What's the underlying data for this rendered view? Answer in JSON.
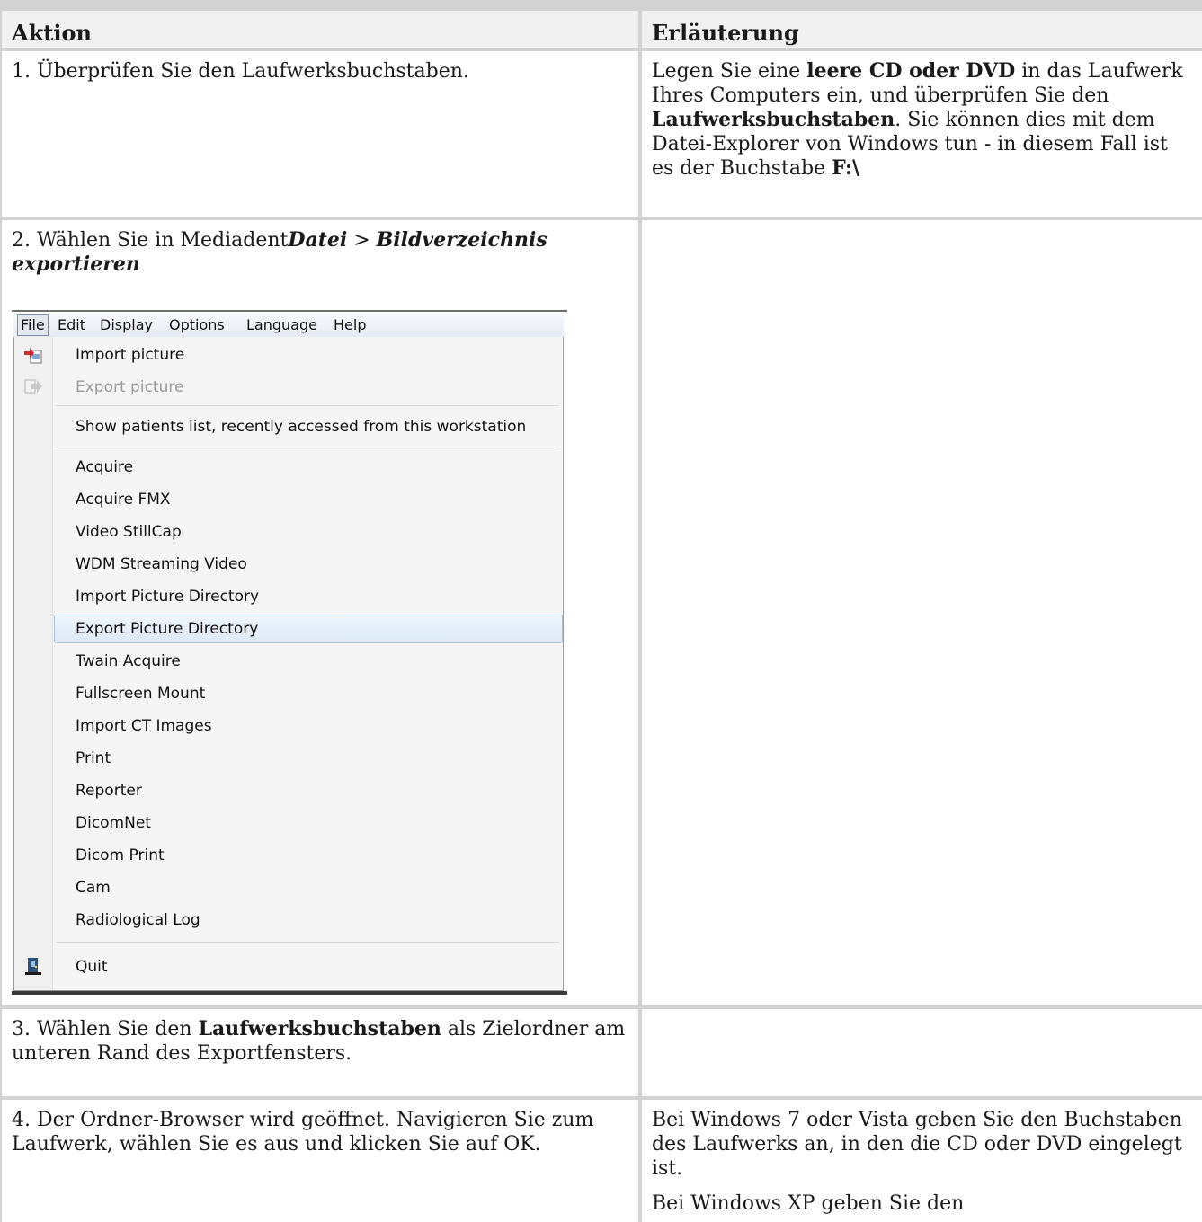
{
  "table": {
    "headers": [
      "Aktion",
      "Erläuterung"
    ],
    "rows": [
      {
        "action": {
          "prefix": "1. Überprüfen Sie den Laufwerksbuchstaben."
        },
        "explanation": {
          "p1": "Legen Sie eine ",
          "b1": "leere CD oder DVD",
          "p2": " in das Laufwerk Ihres Computers ein, und überprüfen Sie den ",
          "b2": "Laufwerksbuchstaben",
          "p3": ". Sie können dies mit dem Datei-Explorer von Windows tun - in diesem Fall ist es der Buchstabe ",
          "b3": "F:\\"
        }
      },
      {
        "action": {
          "prefix": "2. Wählen Sie in Mediadent",
          "i1": "Datei",
          "sep": " > ",
          "i2": "Bildverzeichnis exportieren"
        }
      },
      {
        "action": {
          "p1": "3. Wählen Sie den ",
          "b1": "Laufwerksbuchstaben",
          "p2": " als Zielordner am unteren Rand des Exportfensters."
        }
      },
      {
        "action": {
          "text": "4. Der Ordner-Browser wird geöffnet. Navigieren Sie zum Laufwerk, wählen Sie es aus und klicken Sie auf OK."
        },
        "explanation": {
          "para1": "Bei Windows 7 oder Vista geben Sie den Buchstaben des Laufwerks an, in den die CD oder DVD eingelegt ist.",
          "para2": "Bei Windows XP geben Sie den"
        }
      }
    ]
  },
  "menu": {
    "menubar": [
      "File",
      "Edit",
      "Display",
      "Options",
      "Language",
      "Help"
    ],
    "items": [
      {
        "label": "Import picture",
        "icon": "import-picture-icon"
      },
      {
        "label": "Export picture",
        "icon": "export-picture-icon",
        "disabled": true
      },
      {
        "label": "Show patients list, recently accessed from this workstation"
      },
      {
        "label": "Acquire"
      },
      {
        "label": "Acquire FMX"
      },
      {
        "label": "Video StillCap"
      },
      {
        "label": "WDM Streaming Video"
      },
      {
        "label": "Import Picture Directory"
      },
      {
        "label": "Export Picture Directory",
        "highlighted": true
      },
      {
        "label": "Twain Acquire"
      },
      {
        "label": "Fullscreen Mount"
      },
      {
        "label": "Import CT Images"
      },
      {
        "label": "Print"
      },
      {
        "label": "Reporter"
      },
      {
        "label": "DicomNet"
      },
      {
        "label": "Dicom Print"
      },
      {
        "label": "Cam"
      },
      {
        "label": "Radiological Log"
      },
      {
        "label": "Quit",
        "icon": "quit-icon"
      }
    ],
    "colors": {
      "highlight": "#dde9f7",
      "disabled": "#9a9a9a",
      "header_bg": "#f1f1f1"
    }
  }
}
